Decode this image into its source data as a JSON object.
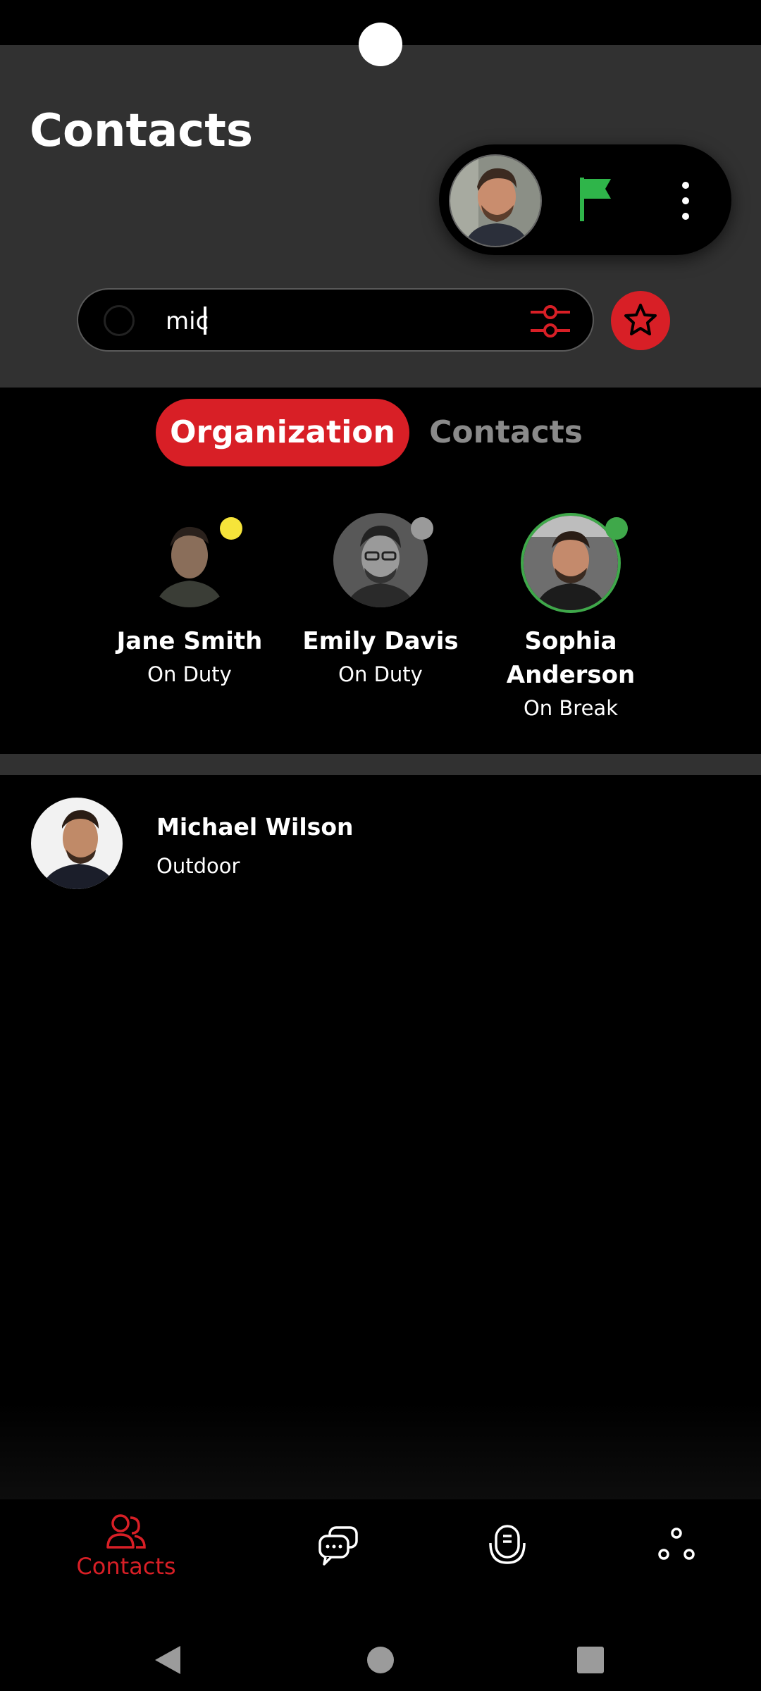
{
  "header": {
    "title": "Contacts"
  },
  "search": {
    "value": "mic"
  },
  "tabs": [
    {
      "label": "Organization",
      "active": true
    },
    {
      "label": "Contacts",
      "active": false
    }
  ],
  "organization": [
    {
      "name": "Jane Smith",
      "status": "On Duty",
      "status_color": "#f6e43a"
    },
    {
      "name": "Emily Davis",
      "status": "On Duty",
      "status_color": "#9a9a9a"
    },
    {
      "name": "Sophia Anderson",
      "status": "On Break",
      "status_color": "#3fa84a"
    }
  ],
  "results": [
    {
      "name": "Michael Wilson",
      "subtitle": "Outdoor"
    }
  ],
  "bottom_nav": [
    {
      "label": "Contacts",
      "icon": "contacts-icon",
      "active": true
    },
    {
      "label": "",
      "icon": "chat-icon",
      "active": false
    },
    {
      "label": "",
      "icon": "walkie-talkie-icon",
      "active": false
    },
    {
      "label": "",
      "icon": "more-apps-icon",
      "active": false
    }
  ],
  "colors": {
    "accent": "#d81f26",
    "header_bg": "#313131",
    "flag": "#2fb54a"
  }
}
